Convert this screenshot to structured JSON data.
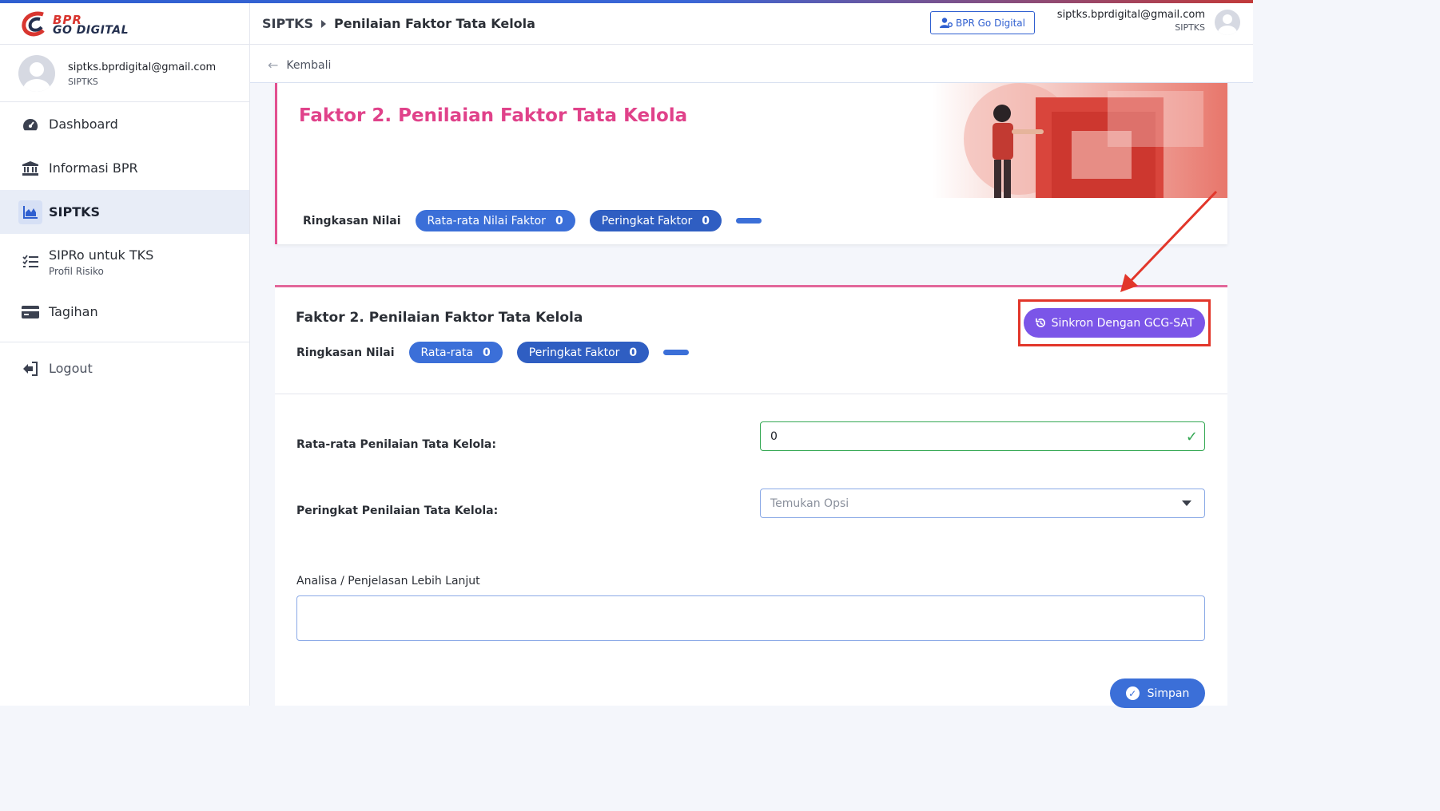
{
  "app": {
    "logo_line1": "BPR",
    "logo_line2": "GO DIGITAL"
  },
  "user": {
    "email": "siptks.bprdigital@gmail.com",
    "role": "SIPTKS"
  },
  "sidebar": {
    "items": [
      {
        "label": "Dashboard",
        "icon": "dashboard-icon"
      },
      {
        "label": "Informasi BPR",
        "icon": "bank-icon"
      },
      {
        "label": "SIPTKS",
        "icon": "chart-area-icon",
        "active": true
      },
      {
        "label": "SIPRo untuk TKS",
        "sublabel": "Profil Risiko",
        "icon": "checklist-icon"
      },
      {
        "label": "Tagihan",
        "icon": "credit-card-icon"
      }
    ],
    "logout_label": "Logout"
  },
  "header": {
    "breadcrumb_root": "SIPTKS",
    "breadcrumb_current": "Penilaian Faktor Tata Kelola",
    "portal_button": "BPR Go Digital"
  },
  "back_label": "Kembali",
  "summary_card": {
    "title": "Faktor 2. Penilaian Faktor Tata Kelola",
    "summary_label": "Ringkasan Nilai",
    "avg_label": "Rata-rata Nilai Faktor",
    "avg_value": "0",
    "rank_label": "Peringkat Faktor",
    "rank_value": "0"
  },
  "form_card": {
    "title": "Faktor 2. Penilaian Faktor Tata Kelola",
    "summary_label": "Ringkasan Nilai",
    "avg_label": "Rata-rata",
    "avg_value": "0",
    "rank_label": "Peringkat Faktor",
    "rank_value": "0",
    "sync_button": "Sinkron Dengan GCG-SAT",
    "avg_field_label": "Rata-rata Penilaian Tata Kelola:",
    "avg_field_value": "0",
    "rank_field_label": "Peringkat Penilaian Tata Kelola:",
    "rank_field_placeholder": "Temukan Opsi",
    "analysis_label": "Analisa / Penjelasan Lebih Lanjut",
    "analysis_value": "",
    "save_button": "Simpan"
  },
  "colors": {
    "primary": "#3b6fd8",
    "accent_pink": "#e0428a",
    "sync_purple": "#7b55e8",
    "highlight_red": "#e2362a",
    "success_green": "#34a853"
  }
}
